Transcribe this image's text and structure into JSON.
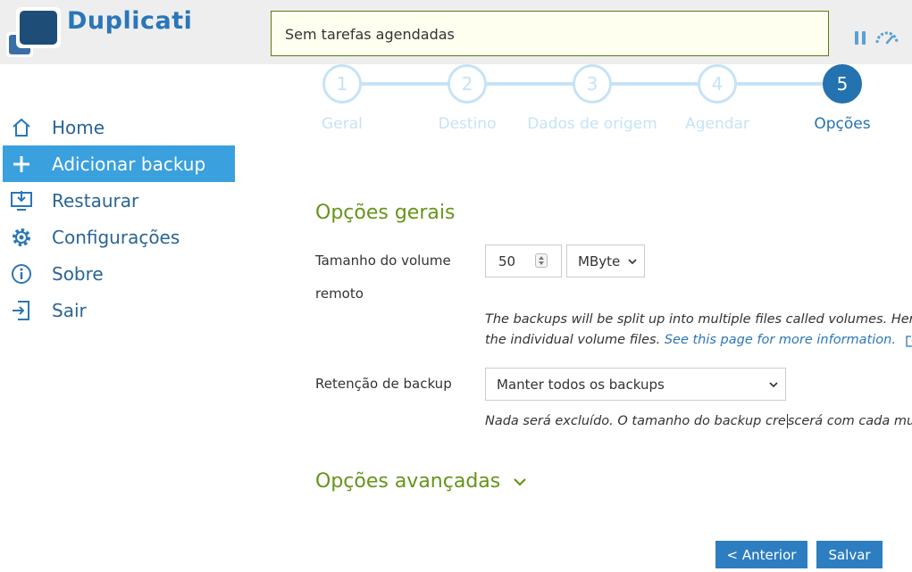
{
  "app": {
    "name": "Duplicati"
  },
  "header": {
    "status_text": "Sem tarefas agendadas"
  },
  "sidebar": {
    "items": [
      {
        "label": "Home",
        "icon": "home-icon",
        "active": false
      },
      {
        "label": "Adicionar backup",
        "icon": "plus-icon",
        "active": true
      },
      {
        "label": "Restaurar",
        "icon": "restore-icon",
        "active": false
      },
      {
        "label": "Configurações",
        "icon": "gear-icon",
        "active": false
      },
      {
        "label": "Sobre",
        "icon": "info-icon",
        "active": false
      },
      {
        "label": "Sair",
        "icon": "logout-icon",
        "active": false
      }
    ]
  },
  "steps": [
    {
      "number": "1",
      "label": "Geral"
    },
    {
      "number": "2",
      "label": "Destino"
    },
    {
      "number": "3",
      "label": "Dados de origem"
    },
    {
      "number": "4",
      "label": "Agendar"
    },
    {
      "number": "5",
      "label": "Opções"
    }
  ],
  "active_step": 5,
  "general_options": {
    "title": "Opções gerais",
    "volume_size": {
      "label_line1": "Tamanho do volume",
      "label_line2": "remoto",
      "value": "50",
      "unit": "MByte",
      "help_line1": "The backups will be split up into multiple files called volumes. Here",
      "help_line2": "the individual volume files.",
      "help_link": "See this page for more information."
    },
    "retention": {
      "label": "Retenção de backup",
      "value": "Manter todos os backups",
      "help_part1": "Nada será excluído. O tamanho do backup cre",
      "help_part2": "scerá com cada mud"
    }
  },
  "advanced_options": {
    "title": "Opções avançadas"
  },
  "buttons": {
    "previous": "< Anterior",
    "save": "Salvar"
  },
  "colors": {
    "accent": "#2472b0",
    "active_nav": "#3aa0de",
    "section_title": "#66941a",
    "step_inactive": "#c6e3f6"
  }
}
